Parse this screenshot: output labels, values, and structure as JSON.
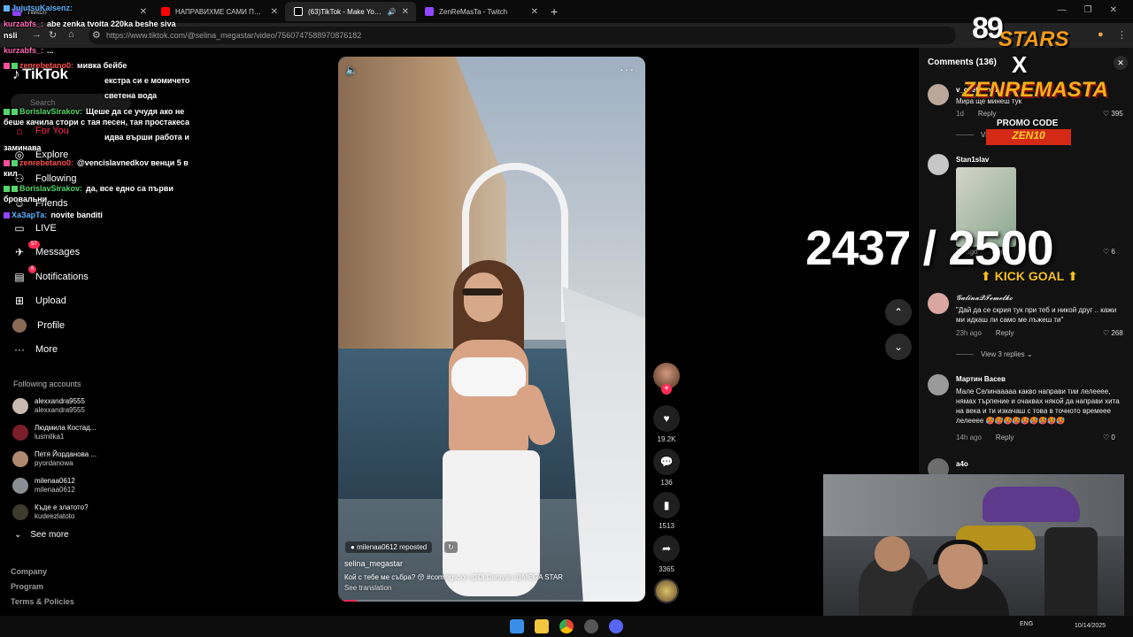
{
  "browser": {
    "tabs": [
      {
        "title": "Twitch",
        "active": false,
        "color": "#9146ff"
      },
      {
        "title": "НАПРАВИХМЕ САМИ ПОКРИВ",
        "active": false,
        "color": "#ff0000"
      },
      {
        "title": "(63)TikTok - Make Your Day",
        "active": true,
        "color": "#ffffff"
      },
      {
        "title": "ZenReMasTa - Twitch",
        "active": false,
        "color": "#9146ff"
      }
    ],
    "url": "https://www.tiktok.com/@selina_megastar/video/7560747588970876182"
  },
  "sidebar": {
    "logo": "TikTok",
    "search_placeholder": "Search",
    "nav": [
      {
        "label": "For You",
        "icon": "home-icon",
        "active": true
      },
      {
        "label": "Explore",
        "icon": "compass-icon",
        "active": false
      },
      {
        "label": "Following",
        "icon": "following-icon",
        "active": false
      },
      {
        "label": "Friends",
        "icon": "friends-icon",
        "active": false
      },
      {
        "label": "LIVE",
        "icon": "live-icon",
        "active": false
      },
      {
        "label": "Messages",
        "icon": "messages-icon",
        "badge": "57",
        "active": false
      },
      {
        "label": "Notifications",
        "icon": "notifications-icon",
        "badge": "6",
        "active": false
      },
      {
        "label": "Upload",
        "icon": "upload-icon",
        "active": false
      },
      {
        "label": "Profile",
        "icon": "profile-icon",
        "active": false
      },
      {
        "label": "More",
        "icon": "more-icon",
        "active": false
      }
    ],
    "following_title": "Following accounts",
    "accounts": [
      {
        "name": "alexxandra9555",
        "handle": "alexxandra9555"
      },
      {
        "name": "Людмила Костад...",
        "handle": "lusmilka1"
      },
      {
        "name": "Петя Йорданова ...",
        "handle": "pyordanowa"
      },
      {
        "name": "milenaa0612",
        "handle": "milenaa0612"
      },
      {
        "name": "Къде е златото?",
        "handle": "kudeezlatoto"
      }
    ],
    "see_more": "See more",
    "footer": [
      "Company",
      "Program",
      "Terms & Policies"
    ]
  },
  "chat": [
    {
      "user": "JujutsuKaisenz:",
      "text": "",
      "color": "#5fb2ff"
    },
    {
      "user": "kurzabfs_:",
      "text": "abe zenka tvoita 220ka beshe siva",
      "color": "#ff69b4"
    },
    {
      "user": "",
      "text": "nsli",
      "color": "#ffffff"
    },
    {
      "user": "kurzabfs_:",
      "text": "...",
      "color": "#ff69b4"
    },
    {
      "user": "zenrebetano0:",
      "text": "мивка бейбе",
      "color": "#ff4f4f"
    },
    {
      "user": "",
      "text": "екстра си е момичето",
      "color": "#ffffff"
    },
    {
      "user": "",
      "text": "светена вода",
      "color": "#ffffff"
    },
    {
      "user": "BorislavSirakov:",
      "text": "Щеше да се учудя ако не",
      "color": "#54d66b"
    },
    {
      "user": "",
      "text": "беше качила стори с тая песен, тая простакеса",
      "color": "#ffffff"
    },
    {
      "user": "",
      "text": "идва върши работа и",
      "color": "#ffffff"
    },
    {
      "user": "",
      "text": "заминава",
      "color": "#ffffff"
    },
    {
      "user": "zenrebetano0:",
      "text": "@vencislavnedkov венци 5 в",
      "color": "#ff4f4f"
    },
    {
      "user": "",
      "text": "кил",
      "color": "#ffffff"
    },
    {
      "user": "BorislavSirakov:",
      "text": "да, все едно са първи",
      "color": "#54d66b"
    },
    {
      "user": "",
      "text": "бровальни",
      "color": "#ffffff"
    },
    {
      "user": "ХаЗарТа:",
      "text": "novite banditi",
      "color": "#5fb2ff"
    }
  ],
  "video": {
    "repost_chip": "milenaa0612 reposted",
    "author": "selina_megastar",
    "caption": "Кой с тебе ме събра? 😚 #comingsoon @Dj Damyan @MEGA STAR",
    "see_translation": "See translation",
    "progress": 0.06
  },
  "actions": {
    "likes": "19.2K",
    "comments": "136",
    "saves": "1513",
    "shares": "3365"
  },
  "comments_panel": {
    "title": "Comments (136)",
    "items": [
      {
        "name": "v_cvetanov7",
        "text": "Мира ще минеш тук",
        "meta": "1d",
        "likes": "395",
        "replies": "View replies"
      },
      {
        "name": "Stan1slav",
        "text": "",
        "meta": "1d ago",
        "likes": "6",
        "replies": ""
      },
      {
        "name": "𝓖𝓪𝓵𝓲𝓷𝓪𝓠𝓣𝓮𝓶𝓮𝓵𝓴𝓸",
        "text": "\"Дай да се скрия тук при теб и никой друг .. кажи ми идкаш ли само ме лъжеш ти\"",
        "meta": "23h ago",
        "likes": "268",
        "replies": "View 3 replies"
      },
      {
        "name": "Мартин Васев",
        "text": "Мале Селинааааа какво направи тии лелееее, нямах търпение и очаквах някой да направи хита на века и ти изкачаш с това в точното времеее лелееее 🥵🥵🥵🥵🥵🥵🥵🥵🥵",
        "meta": "14h ago",
        "likes": "0",
        "replies": ""
      },
      {
        "name": "a4o",
        "text": "",
        "meta": "",
        "likes": "",
        "replies": ""
      }
    ],
    "reply_label": "Reply"
  },
  "overlay": {
    "brand_num": "89",
    "brand_word": "STARS",
    "promo_x": "X",
    "promo_name": "ZENREMASTA",
    "promo_label": "PROMO CODE",
    "promo_code": "ZEN10",
    "goal_count": "2437 / 2500",
    "goal_current": 2437,
    "goal_target": 2500,
    "goal_label": "KICK GOAL"
  },
  "taskbar": {
    "lang": "ENG",
    "date": "10/14/2025"
  }
}
